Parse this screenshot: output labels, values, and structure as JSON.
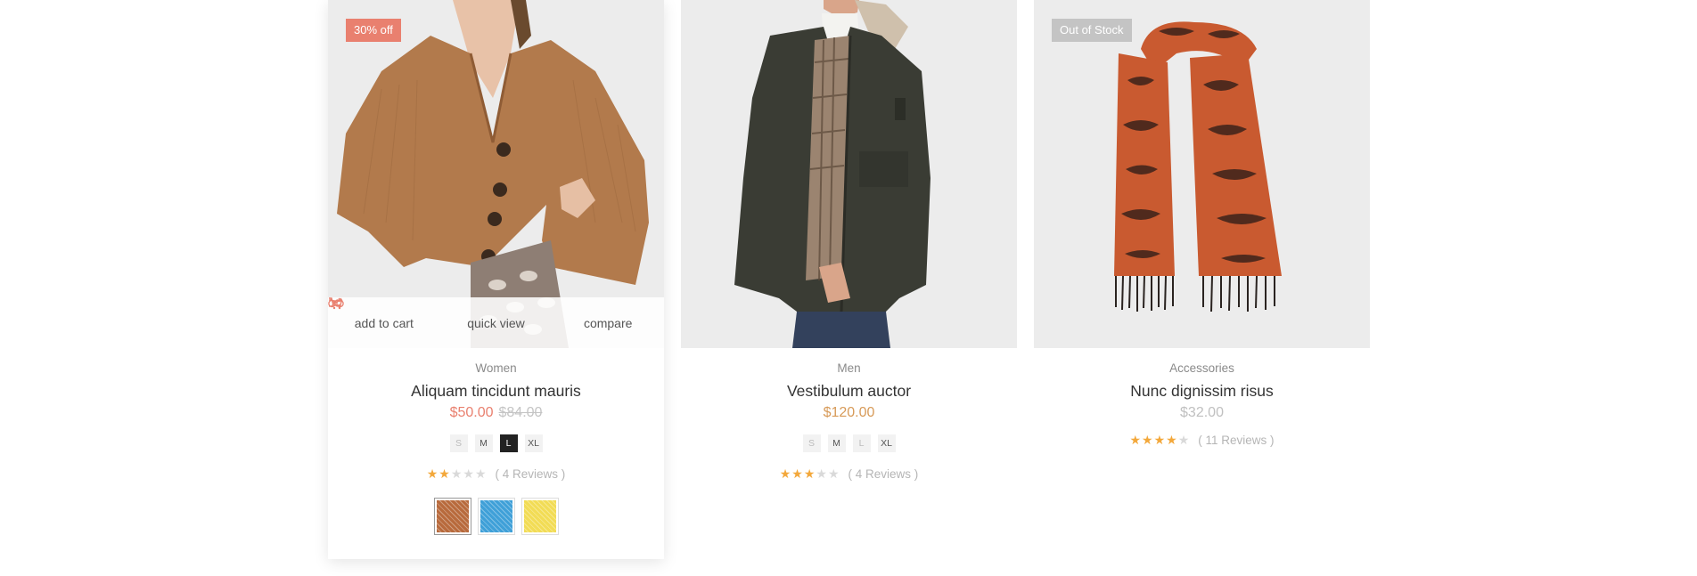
{
  "products": [
    {
      "badge": "30% off",
      "category": "Women",
      "name": "Aliquam tincidunt mauris",
      "price": "$50.00",
      "old_price": "$84.00",
      "sizes": [
        "S",
        "M",
        "L",
        "XL"
      ],
      "selected_size": "L",
      "rating": 2,
      "reviews": "( 4 Reviews )",
      "actions": [
        "add to cart",
        "quick view",
        "compare"
      ],
      "swatch_colors": [
        "#b86a3c",
        "#3fa0d8",
        "#f2dc55"
      ],
      "image": "woman-cardigan"
    },
    {
      "category": "Men",
      "name": "Vestibulum auctor",
      "price": "$120.00",
      "sizes": [
        "S",
        "M",
        "L",
        "XL"
      ],
      "rating": 3,
      "reviews": "( 4 Reviews )",
      "image": "man-parka"
    },
    {
      "badge": "Out of Stock",
      "category": "Accessories",
      "name": "Nunc dignissim risus",
      "price": "$32.00",
      "rating": 4,
      "reviews": "( 11 Reviews )",
      "image": "snake-scarf"
    }
  ],
  "colors": {
    "accent": "#e9806f",
    "price_gold": "#d79a58",
    "star": "#f3a83b",
    "badge_out_of_stock": "#c4c4c4"
  }
}
